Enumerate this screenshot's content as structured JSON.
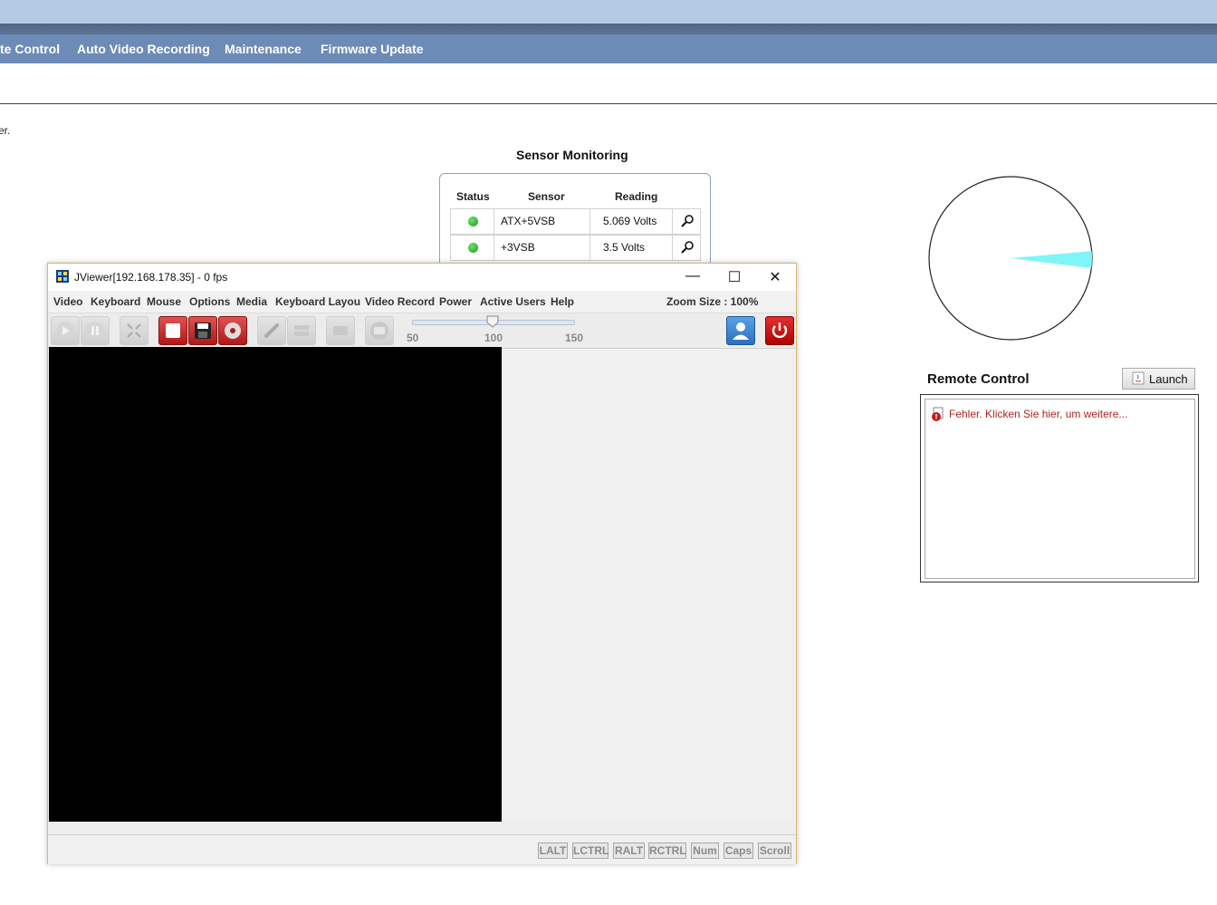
{
  "nav": {
    "items": [
      "te Control",
      "Auto Video Recording",
      "Maintenance",
      "Firmware Update"
    ]
  },
  "page": {
    "subtext": "er."
  },
  "sensor": {
    "title": "Sensor Monitoring",
    "headers": [
      "Status",
      "Sensor",
      "Reading"
    ],
    "rows": [
      {
        "status": "green",
        "sensor": "ATX+5VSB",
        "reading": "5.069 Volts"
      },
      {
        "status": "green",
        "sensor": "+3VSB",
        "reading": "3.5 Volts"
      }
    ]
  },
  "pie": {
    "slice_color": "#7ff5f7",
    "slice_start_deg": -5,
    "slice_end_deg": 7
  },
  "remote_control": {
    "title": "Remote Control",
    "launch_label": "Launch",
    "error_text": "Fehler. Klicken Sie hier, um weitere..."
  },
  "jviewer": {
    "title": "JViewer[192.168.178.35] - 0 fps",
    "menus": [
      "Video",
      "Keyboard",
      "Mouse",
      "Options",
      "Media",
      "Keyboard Layout",
      "Video Record",
      "Power",
      "Active Users",
      "Help"
    ],
    "zoom_size": "Zoom Size : 100%",
    "slider": {
      "min_label": "50",
      "mid_label": "100",
      "max_label": "150",
      "value": 100
    },
    "status_keys": [
      "LALT",
      "LCTRL",
      "RALT",
      "RCTRL",
      "Num",
      "Caps",
      "Scroll"
    ],
    "window_controls": {
      "minimize": "—",
      "maximize": "☐",
      "close": "✕"
    }
  }
}
